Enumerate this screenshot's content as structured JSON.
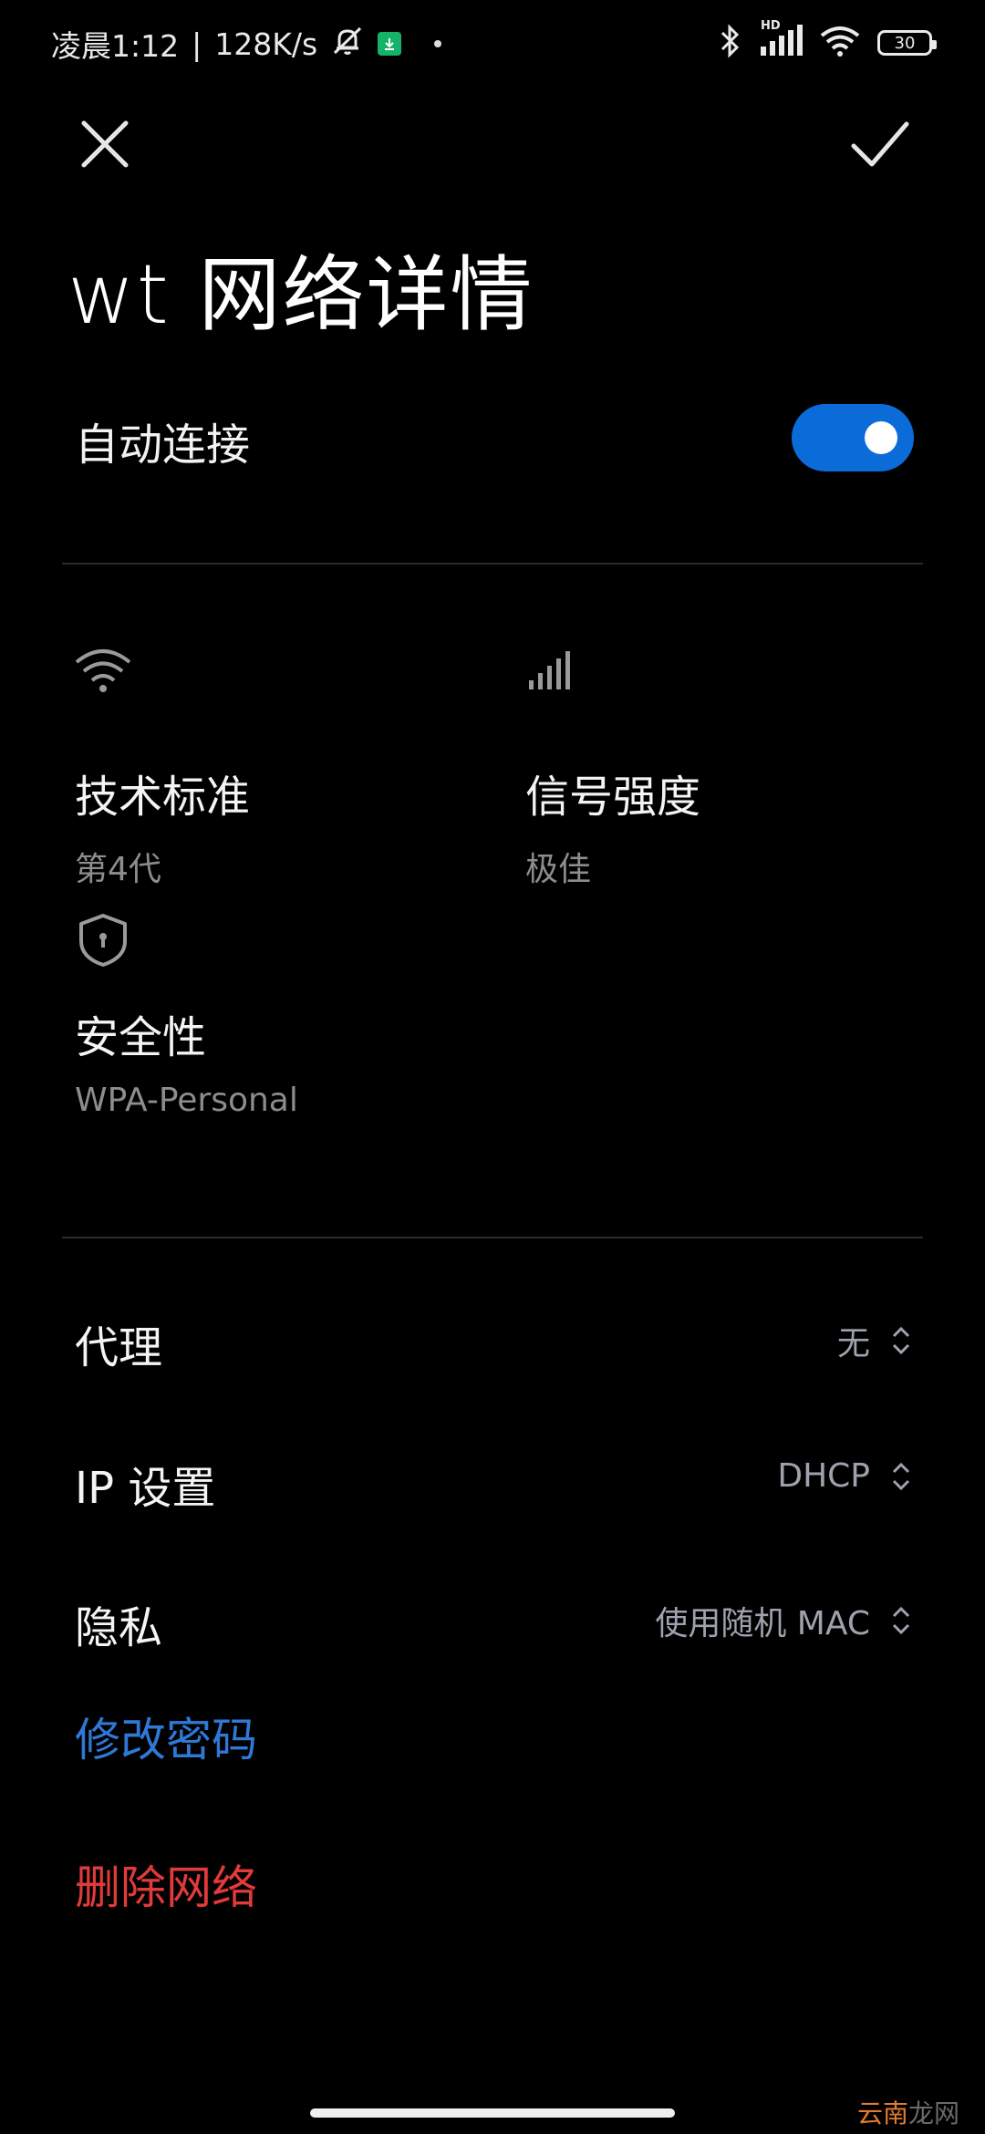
{
  "status_bar": {
    "time": "凌晨1:12",
    "separator": "|",
    "net_speed": "128K/s",
    "battery": "30",
    "network_label": "HD",
    "icons": [
      "bell-muted-icon",
      "download-icon",
      "dot-icon",
      "bluetooth-icon",
      "signal-icon",
      "wifi-icon",
      "battery-icon"
    ]
  },
  "header": {
    "title": "wt 网络详情",
    "close_icon": "close-icon",
    "confirm_icon": "check-icon"
  },
  "auto_connect": {
    "label": "自动连接",
    "enabled": true,
    "accent": "#0b6bd8"
  },
  "info": {
    "tech": {
      "icon": "wifi-icon",
      "title": "技术标准",
      "value": "第4代"
    },
    "signal": {
      "icon": "signal-bars-icon",
      "title": "信号强度",
      "value": "极佳"
    },
    "security": {
      "icon": "shield-lock-icon",
      "title": "安全性",
      "value": "WPA-Personal"
    }
  },
  "settings": [
    {
      "label": "代理",
      "value": "无"
    },
    {
      "label": "IP 设置",
      "value": "DHCP"
    },
    {
      "label": "隐私",
      "value": "使用随机 MAC"
    }
  ],
  "actions": {
    "change_password": "修改密码",
    "delete_network": "删除网络",
    "blue": "#2f78d6",
    "red": "#e13a3a"
  },
  "watermark": {
    "accent": "云南",
    "rest": "龙网"
  }
}
